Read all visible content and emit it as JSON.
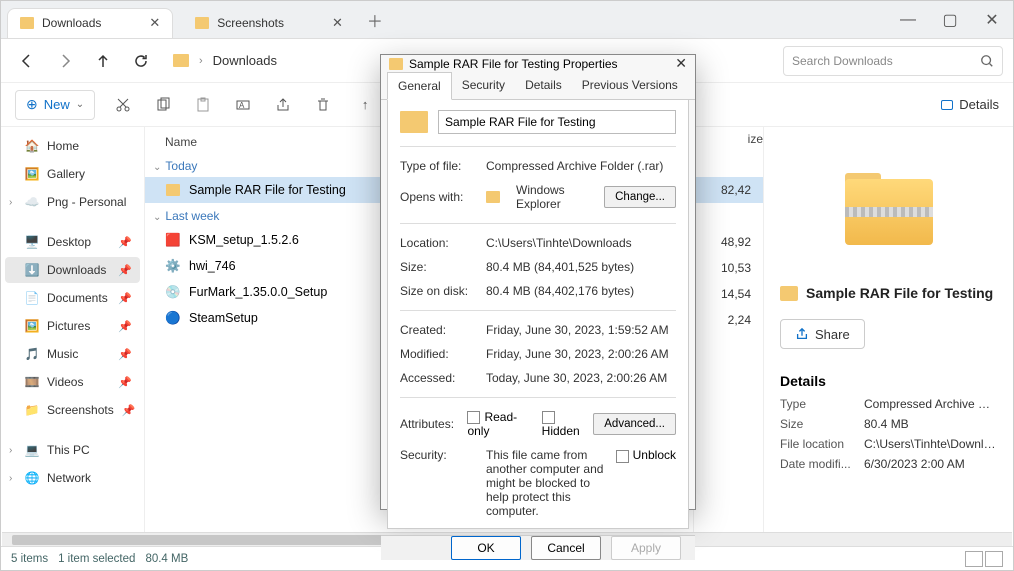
{
  "tabs": [
    {
      "label": "Downloads",
      "active": true
    },
    {
      "label": "Screenshots",
      "active": false
    }
  ],
  "address": {
    "name": "Downloads"
  },
  "search": {
    "placeholder": "Search Downloads"
  },
  "toolbar": {
    "new_label": "New",
    "details_label": "Details"
  },
  "sidebar": {
    "home": "Home",
    "gallery": "Gallery",
    "png": "Png - Personal",
    "desktop": "Desktop",
    "downloads": "Downloads",
    "documents": "Documents",
    "pictures": "Pictures",
    "music": "Music",
    "videos": "Videos",
    "screenshots": "Screenshots",
    "thispc": "This PC",
    "network": "Network"
  },
  "columns": {
    "name": "Name",
    "size": "ize"
  },
  "groups": {
    "today": "Today",
    "lastweek": "Last week"
  },
  "files": {
    "today": [
      {
        "name": "Sample RAR File for Testing",
        "size": "82,42",
        "icon": "zip",
        "selected": true
      }
    ],
    "lastweek": [
      {
        "name": "KSM_setup_1.5.2.6",
        "size": "48,92",
        "icon": "red"
      },
      {
        "name": "hwi_746",
        "size": "10,53",
        "icon": "gear"
      },
      {
        "name": "FurMark_1.35.0.0_Setup",
        "size": "14,54",
        "icon": "disc"
      },
      {
        "name": "SteamSetup",
        "size": "2,24",
        "icon": "steam"
      }
    ]
  },
  "preview": {
    "filename": "Sample RAR File for Testing",
    "share": "Share",
    "details_heading": "Details",
    "rows": [
      {
        "k": "Type",
        "v": "Compressed Archive Fold..."
      },
      {
        "k": "Size",
        "v": "80.4 MB"
      },
      {
        "k": "File location",
        "v": "C:\\Users\\Tinhte\\Downloa..."
      },
      {
        "k": "Date modifi...",
        "v": "6/30/2023 2:00 AM"
      }
    ]
  },
  "status": {
    "items": "5 items",
    "selected": "1 item selected",
    "size": "80.4 MB"
  },
  "dialog": {
    "title": "Sample RAR File for Testing Properties",
    "tabs": [
      "General",
      "Security",
      "Details",
      "Previous Versions"
    ],
    "name": "Sample RAR File for Testing",
    "type_of_file_label": "Type of file:",
    "type_of_file": "Compressed Archive Folder (.rar)",
    "opens_with_label": "Opens with:",
    "opens_with": "Windows Explorer",
    "change": "Change...",
    "location_label": "Location:",
    "location": "C:\\Users\\Tinhte\\Downloads",
    "size_label": "Size:",
    "size": "80.4 MB (84,401,525 bytes)",
    "sizeondisk_label": "Size on disk:",
    "sizeondisk": "80.4 MB (84,402,176 bytes)",
    "created_label": "Created:",
    "created": "Friday, June 30, 2023, 1:59:52 AM",
    "modified_label": "Modified:",
    "modified": "Friday, June 30, 2023, 2:00:26 AM",
    "accessed_label": "Accessed:",
    "accessed": "Today, June 30, 2023, 2:00:26 AM",
    "attributes_label": "Attributes:",
    "readonly": "Read-only",
    "hidden": "Hidden",
    "advanced": "Advanced...",
    "security_label": "Security:",
    "security_text": "This file came from another computer and might be blocked to help protect this computer.",
    "unblock": "Unblock",
    "ok": "OK",
    "cancel": "Cancel",
    "apply": "Apply"
  }
}
